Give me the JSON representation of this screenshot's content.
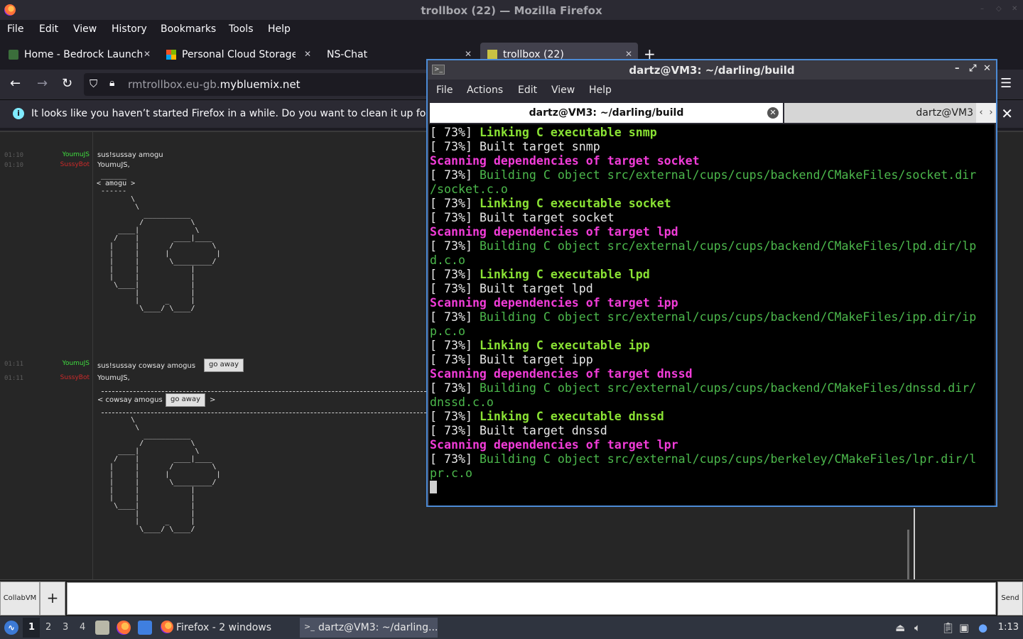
{
  "firefox": {
    "window_title": "trollbox (22) — Mozilla Firefox",
    "menu": [
      "File",
      "Edit",
      "View",
      "History",
      "Bookmarks",
      "Tools",
      "Help"
    ],
    "tabs": [
      {
        "label": "Home - Bedrock Launche",
        "icon": "bedrock-icon"
      },
      {
        "label": "Personal Cloud Storage -",
        "icon": "microsoft-icon"
      },
      {
        "label": "NS-Chat",
        "icon": ""
      },
      {
        "label": "trollbox (22)",
        "icon": "trollbox-icon"
      }
    ],
    "new_tab": "+",
    "url_prefix": "rmtrollbox.eu-gb.",
    "url_domain": "mybluemix.net",
    "infobar_text": "It looks like you haven’t started Firefox in a while. Do you want to clean it up for a f",
    "infobar_icon": "i"
  },
  "trollbox": {
    "messages": [
      {
        "time": "01:10",
        "nick": "YoumuJS",
        "text": "sus!sussay amogu"
      },
      {
        "time": "01:10",
        "nick": "SussyBot",
        "text": "YoumuJS,"
      },
      {
        "time": "01:11",
        "nick": "YoumuJS",
        "text": "sus!sussay cowsay amogus"
      },
      {
        "time": "01:11",
        "nick": "SussyBot",
        "text": "YoumuJS,"
      }
    ],
    "go_away": "go away",
    "bubble1": " ______\n< amogu >\n ------\n        \\\n         \\\n           ___________\n          /           \\\n     ____|             \\\n    /    |        ____|____\n   |     |       /         \\\n   |     |      |           |\n   |     |       \\_________/\n   |     |            |\n   |     |            |\n    \\____|            |\n         |            |\n         |      _     |\n          \\____/ \\____/",
    "bubble2_text": "< cowsay amogus",
    "bubble2_end": ">",
    "crewmate2": "        \\\n         \\\n           ___________\n          /           \\\n     ____|             \\\n    /    |        ____|____\n   |     |       /         \\\n   |     |      |           |\n   |     |       \\_________/\n   |     |            |\n   |     |            |\n    \\____|            |\n         |            |\n         |      _     |\n          \\____/ \\____/",
    "collab_label": "CollabVM",
    "plus_label": "+",
    "send_label": "Send"
  },
  "terminal": {
    "title": "dartz@VM3: ~/darling/build",
    "menu": [
      "File",
      "Actions",
      "Edit",
      "View",
      "Help"
    ],
    "tab1": "dartz@VM3: ~/darling/build",
    "tab2": "dartz@VM3",
    "lines": [
      {
        "pre": "[ 73%] ",
        "text": "Linking C executable snmp",
        "style": "link"
      },
      {
        "pre": "[ 73%] ",
        "text": "Built target snmp",
        "style": "plain"
      },
      {
        "pre": "",
        "text": "Scanning dependencies of target socket",
        "style": "scan"
      },
      {
        "pre": "[ 73%] ",
        "text": "Building C object src/external/cups/cups/backend/CMakeFiles/socket.dir",
        "style": "build"
      },
      {
        "pre": "",
        "text": "/socket.c.o",
        "style": "build"
      },
      {
        "pre": "[ 73%] ",
        "text": "Linking C executable socket",
        "style": "link"
      },
      {
        "pre": "[ 73%] ",
        "text": "Built target socket",
        "style": "plain"
      },
      {
        "pre": "",
        "text": "Scanning dependencies of target lpd",
        "style": "scan"
      },
      {
        "pre": "[ 73%] ",
        "text": "Building C object src/external/cups/cups/backend/CMakeFiles/lpd.dir/lp",
        "style": "build"
      },
      {
        "pre": "",
        "text": "d.c.o",
        "style": "build"
      },
      {
        "pre": "[ 73%] ",
        "text": "Linking C executable lpd",
        "style": "link"
      },
      {
        "pre": "[ 73%] ",
        "text": "Built target lpd",
        "style": "plain"
      },
      {
        "pre": "",
        "text": "Scanning dependencies of target ipp",
        "style": "scan"
      },
      {
        "pre": "[ 73%] ",
        "text": "Building C object src/external/cups/cups/backend/CMakeFiles/ipp.dir/ip",
        "style": "build"
      },
      {
        "pre": "",
        "text": "p.c.o",
        "style": "build"
      },
      {
        "pre": "[ 73%] ",
        "text": "Linking C executable ipp",
        "style": "link"
      },
      {
        "pre": "[ 73%] ",
        "text": "Built target ipp",
        "style": "plain"
      },
      {
        "pre": "",
        "text": "Scanning dependencies of target dnssd",
        "style": "scan"
      },
      {
        "pre": "[ 73%] ",
        "text": "Building C object src/external/cups/cups/backend/CMakeFiles/dnssd.dir/",
        "style": "build"
      },
      {
        "pre": "",
        "text": "dnssd.c.o",
        "style": "build"
      },
      {
        "pre": "[ 73%] ",
        "text": "Linking C executable dnssd",
        "style": "link"
      },
      {
        "pre": "[ 73%] ",
        "text": "Built target dnssd",
        "style": "plain"
      },
      {
        "pre": "",
        "text": "Scanning dependencies of target lpr",
        "style": "scan"
      },
      {
        "pre": "[ 73%] ",
        "text": "Building C object src/external/cups/cups/berkeley/CMakeFiles/lpr.dir/l",
        "style": "build"
      },
      {
        "pre": "",
        "text": "pr.c.o",
        "style": "build"
      }
    ]
  },
  "taskbar": {
    "workspaces": [
      "1",
      "2",
      "3",
      "4"
    ],
    "active_workspace": "1",
    "tasks": [
      {
        "label": "Firefox - 2 windows",
        "icon": "firefox-icon"
      },
      {
        "label": "dartz@VM3: ~/darling...",
        "icon": "terminal-icon"
      }
    ],
    "clock": "1:13"
  },
  "colors": {
    "link": "#8ae234",
    "scan": "#f13cd8",
    "build": "#4cb84c",
    "nick_youmu": "#3fdc3f",
    "nick_sussy": "#cc2a2a",
    "terminal_border": "#4c8bd6"
  }
}
